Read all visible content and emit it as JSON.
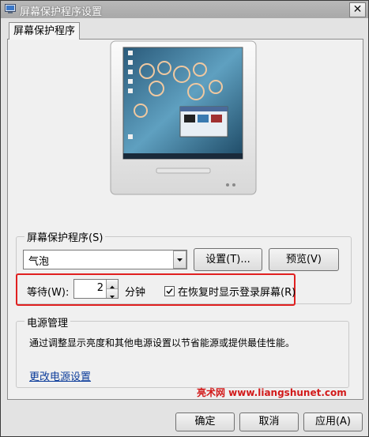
{
  "window": {
    "title": "屏幕保护程序设置",
    "close_label": "✕"
  },
  "tabs": [
    {
      "label": "屏幕保护程序"
    }
  ],
  "screensaver_group": {
    "legend": "屏幕保护程序(S)",
    "selected": "气泡",
    "settings_button": "设置(T)...",
    "preview_button": "预览(V)",
    "wait_label": "等待(W):",
    "wait_value": "2",
    "wait_unit": "分钟",
    "resume_checkbox_label": "在恢复时显示登录屏幕(R)",
    "resume_checked": true
  },
  "power_group": {
    "legend": "电源管理",
    "description": "通过调整显示亮度和其他电源设置以节省能源或提供最佳性能。",
    "link": "更改电源设置"
  },
  "watermark": "亮术网 www.liangshunet.com",
  "buttons": {
    "ok": "确定",
    "cancel": "取消",
    "apply": "应用(A)"
  },
  "colors": {
    "highlight_box": "#e02020",
    "link": "#0c3c9a"
  }
}
